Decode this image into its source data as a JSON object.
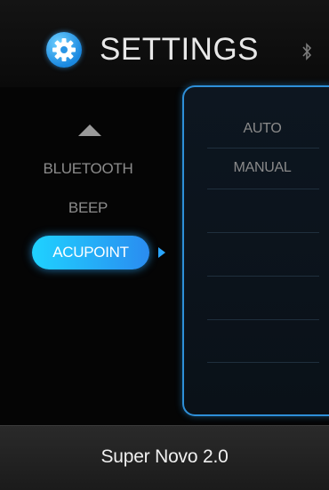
{
  "header": {
    "title": "SETTINGS",
    "settings_icon": "gear-icon",
    "bluetooth_icon": "bluetooth-icon"
  },
  "menu": {
    "scroll_up_icon": "chevron-up-icon",
    "items": [
      {
        "label": "BLUETOOTH",
        "selected": false
      },
      {
        "label": "BEEP",
        "selected": false
      },
      {
        "label": "ACUPOINT",
        "selected": true
      }
    ],
    "selected_indicator_icon": "triangle-right-icon"
  },
  "options": {
    "items": [
      {
        "label": "AUTO"
      },
      {
        "label": "MANUAL"
      }
    ]
  },
  "footer": {
    "device_name": "Super Novo 2.0"
  },
  "colors": {
    "accent": "#1fa8f5",
    "background": "#050505"
  }
}
